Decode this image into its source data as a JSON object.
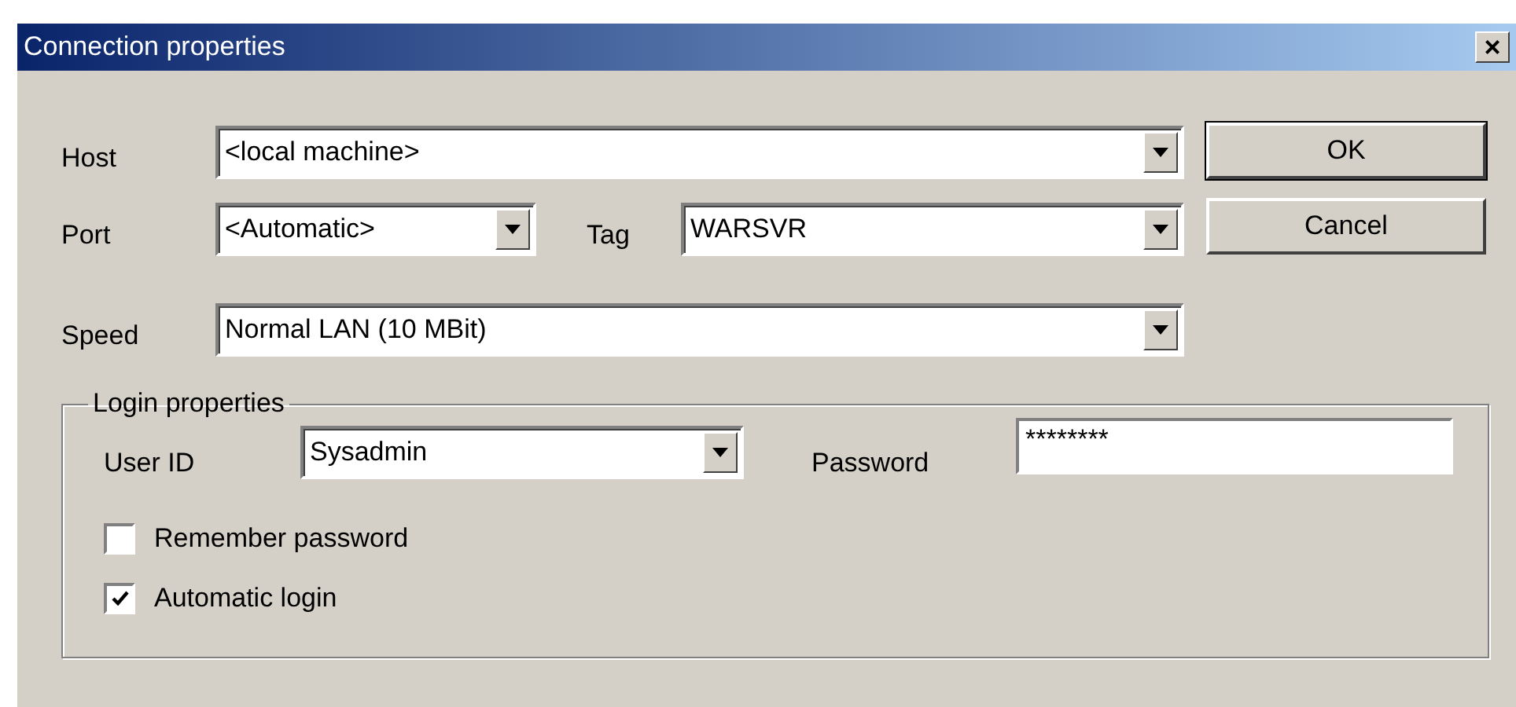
{
  "window": {
    "title": "Connection properties",
    "close": "×"
  },
  "fields": [
    {
      "label": "Host",
      "value": "<local machine>"
    },
    {
      "label": "Port",
      "value": "<Automatic>"
    },
    {
      "label": "Tag",
      "value": "WARSVR"
    },
    {
      "label": "Speed",
      "value": "Normal LAN (10 MBit)"
    }
  ],
  "buttons": [
    {
      "label": "OK",
      "default": true
    },
    {
      "label": "Cancel",
      "default": false
    }
  ],
  "login": {
    "title": "Login properties",
    "user_id": {
      "label": "User ID",
      "value": "Sysadmin"
    },
    "password": {
      "label": "Password",
      "value": "********"
    },
    "checkboxes": [
      {
        "label": "Remember password",
        "checked": false
      },
      {
        "label": "Automatic login",
        "checked": true
      }
    ]
  }
}
